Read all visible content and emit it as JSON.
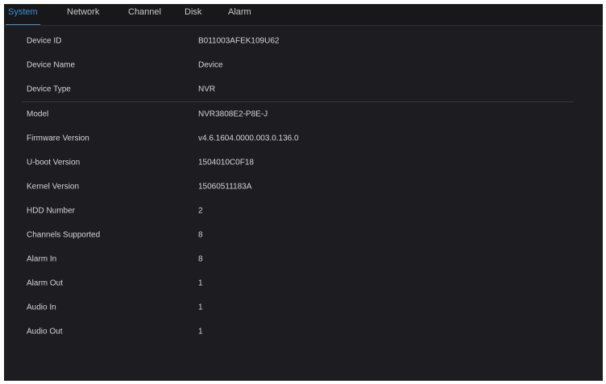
{
  "tabs": [
    {
      "label": "System",
      "active": true
    },
    {
      "label": "Network",
      "active": false
    },
    {
      "label": "Channel",
      "active": false
    },
    {
      "label": "Disk",
      "active": false
    },
    {
      "label": "Alarm",
      "active": false
    }
  ],
  "info": [
    {
      "label": "Device ID",
      "value": "B011003AFEK109U62"
    },
    {
      "label": "Device Name",
      "value": "Device"
    },
    {
      "label": "Device Type",
      "value": "NVR"
    },
    {
      "label": "Model",
      "value": "NVR3808E2-P8E-J"
    },
    {
      "label": "Firmware Version",
      "value": "v4.6.1604.0000.003.0.136.0"
    },
    {
      "label": "U-boot Version",
      "value": "1504010C0F18"
    },
    {
      "label": "Kernel Version",
      "value": "15060511183A"
    },
    {
      "label": "HDD Number",
      "value": "2"
    },
    {
      "label": "Channels Supported",
      "value": "8"
    },
    {
      "label": "Alarm In",
      "value": "8"
    },
    {
      "label": "Alarm Out",
      "value": "1"
    },
    {
      "label": "Audio In",
      "value": "1"
    },
    {
      "label": "Audio Out",
      "value": "1"
    }
  ],
  "colors": {
    "background": "#1d1d21",
    "text": "#d4d4d6",
    "accent": "#3a8fd9"
  }
}
